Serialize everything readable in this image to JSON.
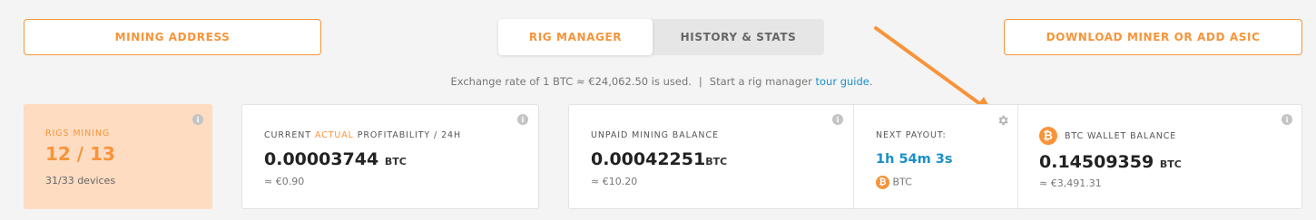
{
  "header": {
    "mining_address": "MINING ADDRESS",
    "download": "DOWNLOAD MINER OR ADD ASIC",
    "tabs": [
      {
        "label": "RIG MANAGER",
        "active": true
      },
      {
        "label": "HISTORY & STATS",
        "active": false
      }
    ]
  },
  "exchange": {
    "text": "Exchange rate of 1 BTC ≈ €24,062.50 is used.",
    "separator": "|",
    "tour_prefix": "Start a rig manager",
    "tour_link": "tour guide",
    "tour_suffix": "."
  },
  "rigs": {
    "label": "RIGS MINING",
    "value": "12 / 13",
    "devices": "31/33 devices"
  },
  "profitability": {
    "label_prefix": "CURRENT",
    "label_highlight": "ACTUAL",
    "label_suffix": "PROFITABILITY / 24H",
    "value": "0.00003744",
    "unit": "BTC",
    "fiat": "≈ €0.90"
  },
  "unpaid": {
    "label": "UNPAID MINING BALANCE",
    "value": "0.00042251",
    "unit": "BTC",
    "fiat": "≈ €10.20"
  },
  "payout": {
    "label": "NEXT PAYOUT:",
    "time": "1h 54m 3s",
    "currency": "BTC"
  },
  "wallet": {
    "label": "BTC WALLET BALANCE",
    "value": "0.14509359",
    "unit": "BTC",
    "fiat": "≈ €3,491.31"
  },
  "icons": {
    "info": "info-icon",
    "gear": "gear-icon",
    "btc": "bitcoin-icon",
    "arrow": "annotation-arrow"
  },
  "colors": {
    "accent": "#f7943a",
    "link": "#1a8fc9",
    "rigs_bg": "#fddcc1"
  }
}
